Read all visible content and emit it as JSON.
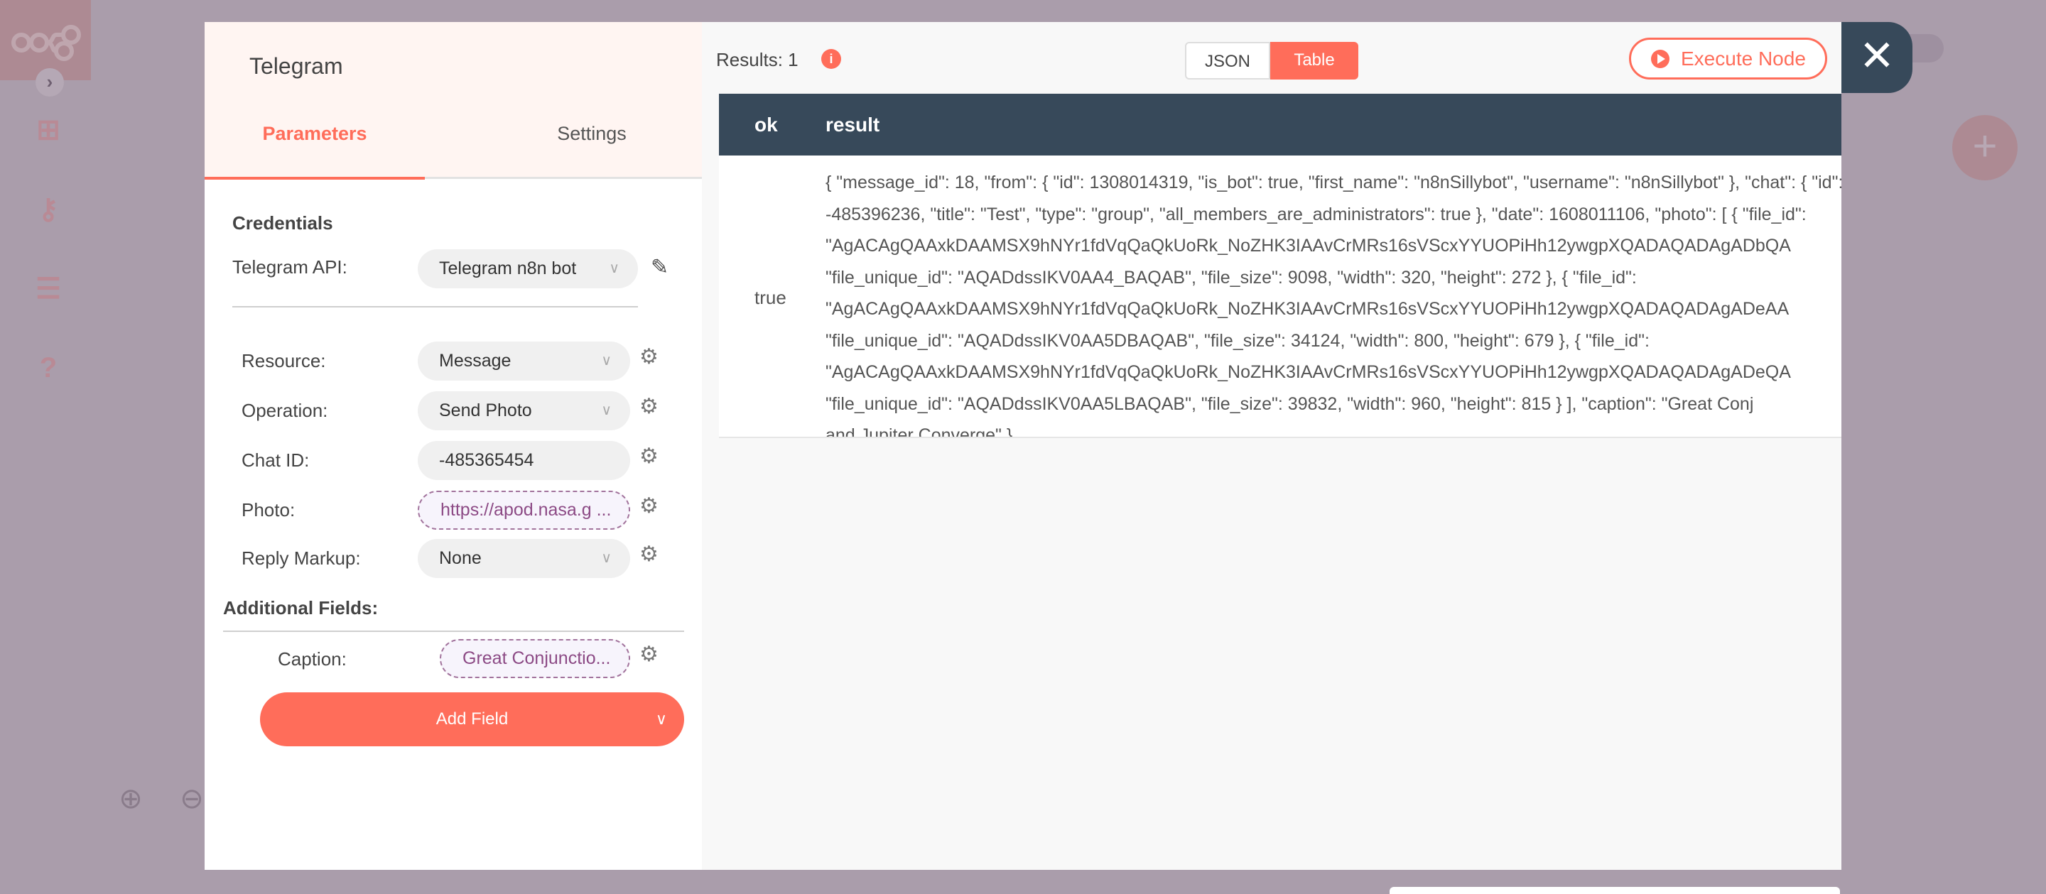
{
  "sidebar": {
    "icons": [
      "n8n-logo-icon",
      "chevron-right-icon",
      "network-icon",
      "key-icon",
      "tasks-icon",
      "question-icon"
    ]
  },
  "node": {
    "title": "Telegram",
    "tabs": [
      {
        "label": "Parameters",
        "active": true
      },
      {
        "label": "Settings",
        "active": false
      }
    ]
  },
  "credentials": {
    "heading": "Credentials",
    "label": "Telegram API:",
    "value": "Telegram n8n bot"
  },
  "params": [
    {
      "label": "Resource:",
      "value": "Message",
      "type": "select"
    },
    {
      "label": "Operation:",
      "value": "Send Photo",
      "type": "select"
    },
    {
      "label": "Chat ID:",
      "value": "-485365454",
      "type": "input"
    },
    {
      "label": "Photo:",
      "value": "https://apod.nasa.g ...",
      "type": "expression"
    },
    {
      "label": "Reply Markup:",
      "value": "None",
      "type": "select"
    }
  ],
  "additional": {
    "heading": "Additional Fields:",
    "caption_label": "Caption:",
    "caption_value": "Great Conjunctio...",
    "add_field": "Add Field"
  },
  "output": {
    "results": "Results: 1",
    "views": {
      "json": "JSON",
      "table": "Table",
      "active": "Table"
    },
    "execute": "Execute Node",
    "columns": [
      "ok",
      "result"
    ],
    "row": {
      "ok": "true",
      "result_lines": [
        "{ \"message_id\": 18, \"from\": { \"id\": 1308014319, \"is_bot\": true, \"first_name\": \"n8nSillybot\", \"username\": \"n8nSillybot\" }, \"chat\": { \"id\":",
        "-485396236, \"title\": \"Test\", \"type\": \"group\", \"all_members_are_administrators\": true }, \"date\": 1608011106, \"photo\": [ { \"file_id\":",
        "\"AgACAgQAAxkDAAMSX9hNYr1fdVqQaQkUoRk_NoZHK3IAAvCrMRs16sVScxYYUOPiHh12ywgpXQADAQADAgADbQA",
        "\"file_unique_id\": \"AQADdssIKV0AA4_BAQAB\", \"file_size\": 9098, \"width\": 320, \"height\": 272 }, { \"file_id\":",
        "\"AgACAgQAAxkDAAMSX9hNYr1fdVqQaQkUoRk_NoZHK3IAAvCrMRs16sVScxYYUOPiHh12ywgpXQADAQADAgADeAA",
        "\"file_unique_id\": \"AQADdssIKV0AA5DBAQAB\", \"file_size\": 34124, \"width\": 800, \"height\": 679 }, { \"file_id\":",
        "\"AgACAgQAAxkDAAMSX9hNYr1fdVqQaQkUoRk_NoZHK3IAAvCrMRs16sVScxYYUOPiHh12ywgpXQADAQADAgADeQA",
        "\"file_unique_id\": \"AQADdssIKV0AA5LBAQAB\", \"file_size\": 39832, \"width\": 960, \"height\": 815 } ], \"caption\": \"Great Conj",
        "and Jupiter Converge\" }"
      ]
    }
  },
  "colors": {
    "accent": "#ff6d5a",
    "header": "#37495a",
    "overlay": "#aa9dab",
    "expression": "#8c4a85"
  }
}
